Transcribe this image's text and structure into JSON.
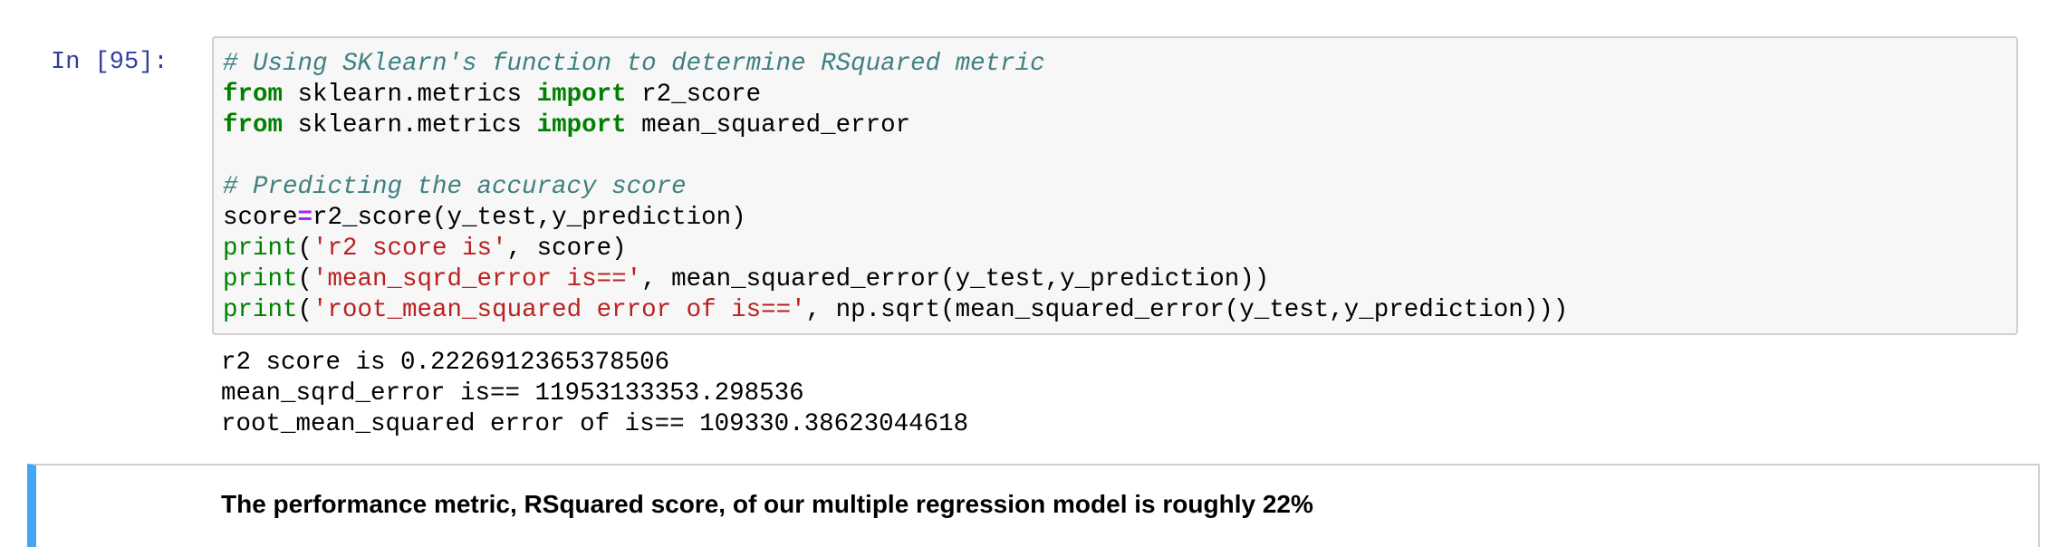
{
  "code_cell": {
    "prompt": "In [95]:",
    "lines": [
      {
        "tokens": [
          {
            "type": "comment",
            "text": "# Using SKlearn's function to determine RSquared metric"
          }
        ]
      },
      {
        "tokens": [
          {
            "type": "keyword",
            "text": "from"
          },
          {
            "type": "plain",
            "text": " sklearn.metrics "
          },
          {
            "type": "keyword",
            "text": "import"
          },
          {
            "type": "plain",
            "text": " r2_score"
          }
        ]
      },
      {
        "tokens": [
          {
            "type": "keyword",
            "text": "from"
          },
          {
            "type": "plain",
            "text": " sklearn.metrics "
          },
          {
            "type": "keyword",
            "text": "import"
          },
          {
            "type": "plain",
            "text": " mean_squared_error"
          }
        ]
      },
      {
        "tokens": [
          {
            "type": "plain",
            "text": ""
          }
        ]
      },
      {
        "tokens": [
          {
            "type": "comment",
            "text": "# Predicting the accuracy score"
          }
        ]
      },
      {
        "tokens": [
          {
            "type": "plain",
            "text": "score"
          },
          {
            "type": "operator",
            "text": "="
          },
          {
            "type": "plain",
            "text": "r2_score(y_test,y_prediction)"
          }
        ]
      },
      {
        "tokens": [
          {
            "type": "builtin",
            "text": "print"
          },
          {
            "type": "plain",
            "text": "("
          },
          {
            "type": "string",
            "text": "'r2 score is'"
          },
          {
            "type": "plain",
            "text": ", score)"
          }
        ]
      },
      {
        "tokens": [
          {
            "type": "builtin",
            "text": "print"
          },
          {
            "type": "plain",
            "text": "("
          },
          {
            "type": "string",
            "text": "'mean_sqrd_error is=='"
          },
          {
            "type": "plain",
            "text": ", mean_squared_error(y_test,y_prediction))"
          }
        ]
      },
      {
        "tokens": [
          {
            "type": "builtin",
            "text": "print"
          },
          {
            "type": "plain",
            "text": "("
          },
          {
            "type": "string",
            "text": "'root_mean_squared error of is=='"
          },
          {
            "type": "plain",
            "text": ", np.sqrt(mean_squared_error(y_test,y_prediction)))"
          }
        ]
      }
    ]
  },
  "output": {
    "lines": [
      "r2 score is 0.2226912365378506",
      "mean_sqrd_error is== 11953133353.298536",
      "root_mean_squared error of is== 109330.38623044618"
    ]
  },
  "markdown_cell": {
    "text": "The performance metric, RSquared score, of our multiple regression model is roughly 22%"
  },
  "colors": {
    "prompt": "#303f9f",
    "comment": "#408080",
    "keyword": "#008000",
    "string": "#ba2121",
    "operator": "#aa22ff",
    "selected_cell_bar": "#42a5f5"
  }
}
